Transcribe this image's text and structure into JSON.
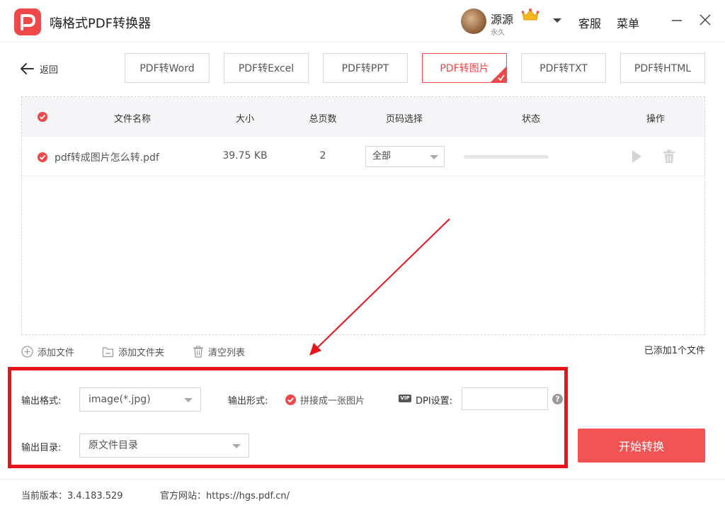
{
  "app": {
    "title": "嗨格式PDF转换器"
  },
  "user": {
    "name": "源源",
    "subtitle": "永久"
  },
  "header": {
    "service_label": "客服",
    "menu_label": "菜单"
  },
  "nav": {
    "back_label": "返回"
  },
  "tabs": [
    {
      "label": "PDF转Word",
      "active": false
    },
    {
      "label": "PDF转Excel",
      "active": false
    },
    {
      "label": "PDF转PPT",
      "active": false
    },
    {
      "label": "PDF转图片",
      "active": true
    },
    {
      "label": "PDF转TXT",
      "active": false
    },
    {
      "label": "PDF转HTML",
      "active": false
    }
  ],
  "table": {
    "columns": {
      "name": "文件名称",
      "size": "大小",
      "pages": "总页数",
      "page_select": "页码选择",
      "status": "状态",
      "actions": "操作"
    },
    "rows": [
      {
        "name": "pdf转成图片怎么转.pdf",
        "size": "39.75 KB",
        "pages": "2",
        "page_select": "全部",
        "progress": 0
      }
    ]
  },
  "tools": {
    "add_file": "添加文件",
    "add_folder": "添加文件夹",
    "clear_list": "清空列表",
    "added_count": "已添加1个文件"
  },
  "settings": {
    "format_label": "输出格式:",
    "format_value": "image(*.jpg)",
    "form_label": "输出形式:",
    "form_option": "拼接成一张图片",
    "dpi_label": "DPI设置:",
    "dpi_value": "",
    "dir_label": "输出目录:",
    "dir_value": "原文件目录",
    "help_symbol": "?",
    "dpi_badge": "VIP"
  },
  "start_button": "开始转换",
  "footer": {
    "version": "当前版本：3.4.183.529",
    "website": "官方网站：https://hgs.pdf.cn/"
  },
  "colors": {
    "accent": "#f04848",
    "highlight_box": "#e8141c",
    "start_button": "#f25454"
  },
  "icons": [
    "logo-icon",
    "crown-icon",
    "chevron-down-icon",
    "close-icon",
    "minimize-icon",
    "back-arrow-icon",
    "check-icon",
    "play-icon",
    "trash-icon",
    "plus-circle-icon",
    "folder-icon",
    "help-icon"
  ]
}
